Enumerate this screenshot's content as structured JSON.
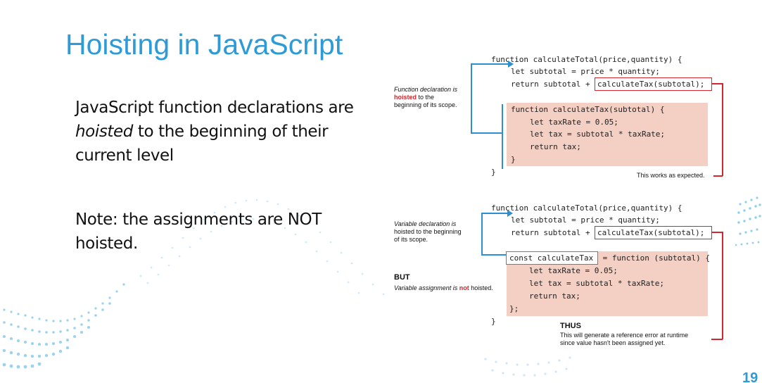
{
  "title": "Hoisting in JavaScript",
  "body": {
    "p1_prefix": "JavaScript function declarations are ",
    "p1_emph": "hoisted",
    "p1_suffix": " to the beginning of their current level",
    "p2": "Note: the assignments are NOT hoisted."
  },
  "figure": {
    "top": {
      "sig": "function calculateTotal(price,quantity) {",
      "line1": "let subtotal = price * quantity;",
      "line2_prefix": "return subtotal + ",
      "line2_call": "calculateTax(subtotal);",
      "fn_sig": "function calculateTax(subtotal) {",
      "fn_l1": "let taxRate = 0.05;",
      "fn_l2": "let tax = subtotal * taxRate;",
      "fn_l3": "return tax;",
      "fn_close": "}",
      "close": "}",
      "note_i1": "Function declaration is",
      "note_hoisted": "hoisted",
      "note_tail": " to the",
      "note_3": "beginning of its scope.",
      "works": "This works as expected."
    },
    "bottom": {
      "sig": "function calculateTotal(price,quantity) {",
      "line1": "let subtotal = price * quantity;",
      "line2_prefix": "return subtotal + ",
      "line2_call": "calculateTax(subtotal);",
      "const_decl": "const calculateTax",
      "const_rest": " = function (subtotal) {",
      "fn_l1": "let taxRate = 0.05;",
      "fn_l2": "let tax = subtotal * taxRate;",
      "fn_l3": "return tax;",
      "fn_close": "};",
      "close": "}",
      "note1": "Variable declaration is",
      "note2": "hoisted to the beginning",
      "note3": "of its scope.",
      "but": "BUT",
      "assign_prefix": "Variable assignment is ",
      "assign_not": "not",
      "assign_suffix": " hoisted.",
      "thus": "THUS",
      "thus1": "This will generate a reference error at runtime",
      "thus2": "since value hasn't been assigned yet."
    }
  },
  "slide_number": "19",
  "colors": {
    "title": "#2e9bd6",
    "highlight": "#f3cfc4",
    "red": "#d0282e",
    "blue": "#2e8fd0"
  }
}
